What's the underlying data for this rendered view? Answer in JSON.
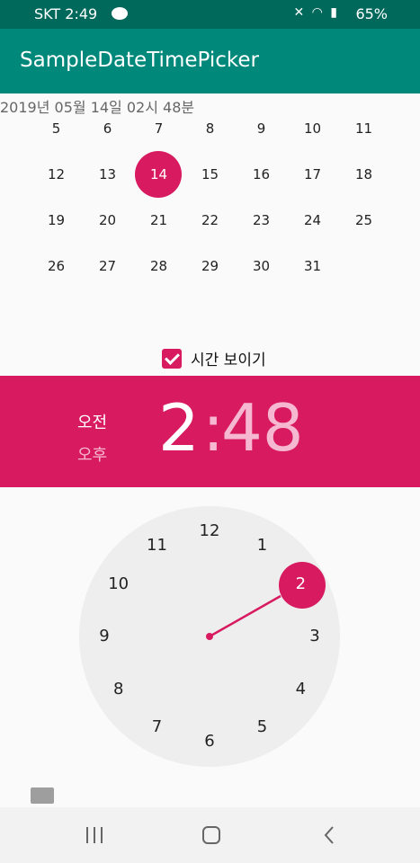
{
  "status_bar": {
    "carrier_time": "SKT 2:49",
    "battery": "65%"
  },
  "app_bar": {
    "title": "SampleDateTimePicker"
  },
  "datetime_text": "2019년 05월 14일 02시 48분",
  "calendar": {
    "partial_row": [
      "5",
      "6",
      "7",
      "8",
      "9",
      "10",
      "11"
    ],
    "rows": [
      [
        "12",
        "13",
        "14",
        "15",
        "16",
        "17",
        "18"
      ],
      [
        "19",
        "20",
        "21",
        "22",
        "23",
        "24",
        "25"
      ],
      [
        "26",
        "27",
        "28",
        "29",
        "30",
        "31",
        ""
      ]
    ],
    "selected_day": "14"
  },
  "show_time_checkbox": {
    "label": "시간 보이기",
    "checked": true
  },
  "time_header": {
    "am": "오전",
    "pm": "오후",
    "hour": "2",
    "separator": ":",
    "minute": "48"
  },
  "clock": {
    "numbers": [
      "12",
      "1",
      "2",
      "3",
      "4",
      "5",
      "6",
      "7",
      "8",
      "9",
      "10",
      "11"
    ],
    "selected": "2"
  },
  "colors": {
    "accent": "#d81b60",
    "primary": "#00897b",
    "primary_dark": "#00695c"
  }
}
